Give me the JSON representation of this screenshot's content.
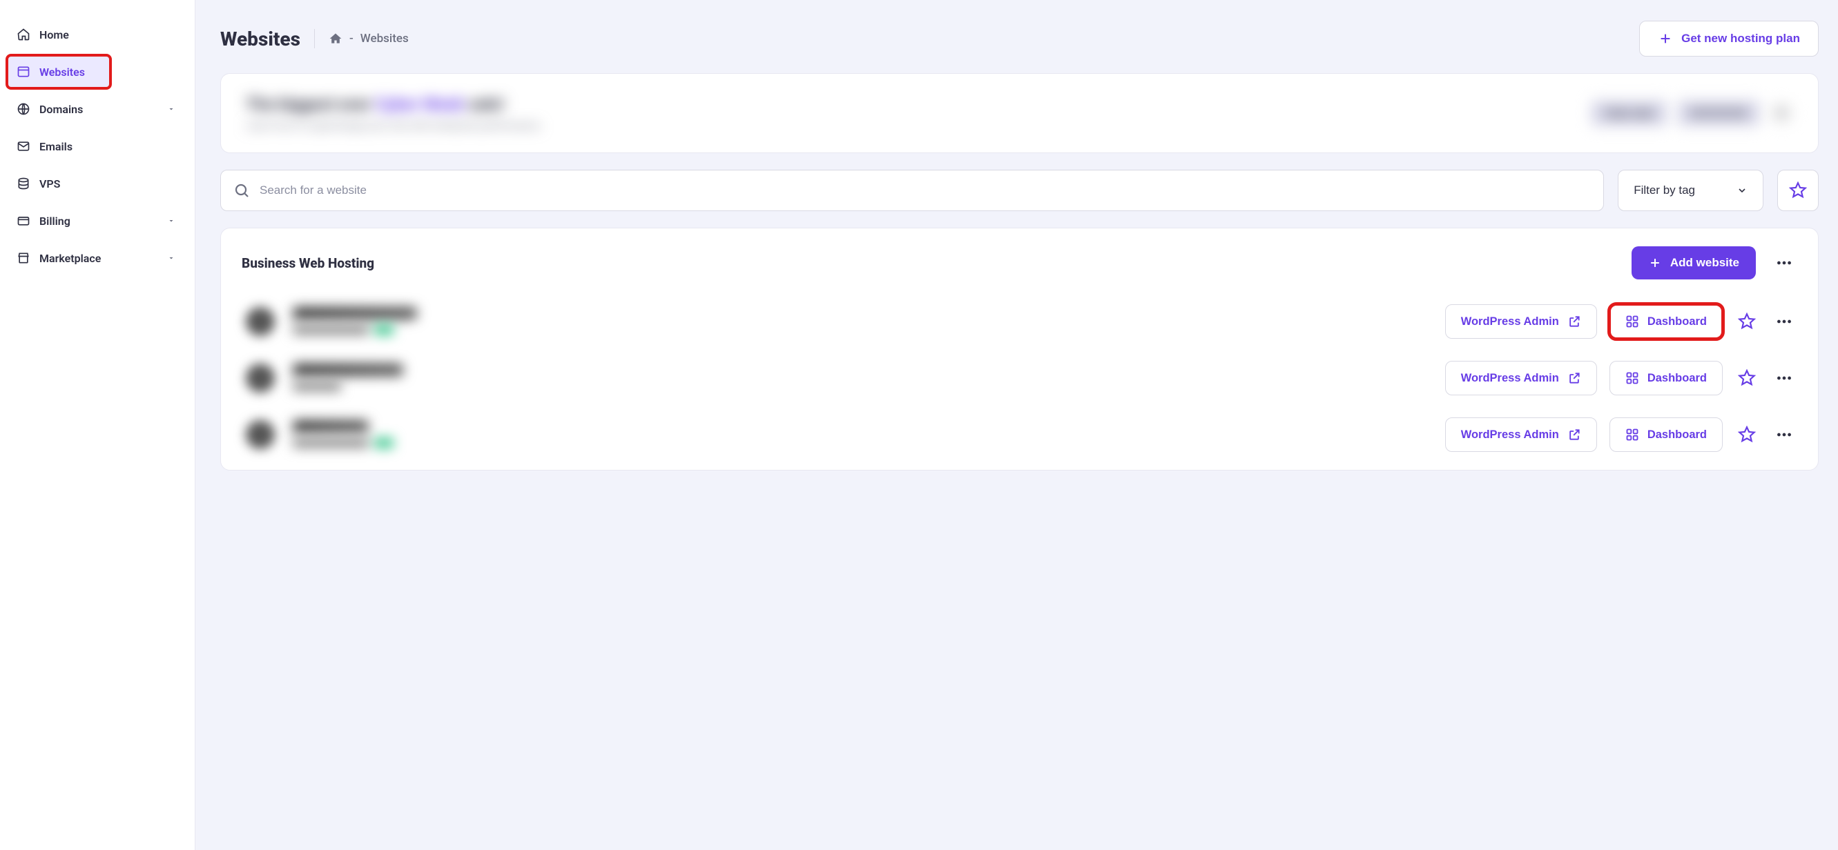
{
  "sidebar": {
    "items": [
      {
        "id": "home",
        "label": "Home",
        "icon": "home-icon",
        "expandable": false
      },
      {
        "id": "websites",
        "label": "Websites",
        "icon": "window-icon",
        "expandable": false,
        "active": true,
        "highlighted": true
      },
      {
        "id": "domains",
        "label": "Domains",
        "icon": "globe-icon",
        "expandable": true
      },
      {
        "id": "emails",
        "label": "Emails",
        "icon": "mail-icon",
        "expandable": false
      },
      {
        "id": "vps",
        "label": "VPS",
        "icon": "database-icon",
        "expandable": false
      },
      {
        "id": "billing",
        "label": "Billing",
        "icon": "card-icon",
        "expandable": true
      },
      {
        "id": "marketplace",
        "label": "Marketplace",
        "icon": "store-icon",
        "expandable": true
      }
    ]
  },
  "header": {
    "title": "Websites",
    "breadcrumb_sep": "-",
    "breadcrumb_current": "Websites",
    "new_plan_label": "Get new hosting plan"
  },
  "promo": {
    "line1_a": "The biggest ever",
    "line1_b": "Cyber Week",
    "line1_c": "sale!",
    "line2": "Learn how to supercharge your site with enterprise performance.",
    "cta": "Claim deal",
    "timer": "00 00 00 00"
  },
  "filters": {
    "search_placeholder": "Search for a website",
    "filter_label": "Filter by tag"
  },
  "hosting": {
    "title": "Business Web Hosting",
    "add_label": "Add website",
    "wp_admin_label": "WordPress Admin",
    "dashboard_label": "Dashboard",
    "rows": [
      {
        "id": "site1",
        "highlighted_dashboard": true
      },
      {
        "id": "site2",
        "highlighted_dashboard": false
      },
      {
        "id": "site3",
        "highlighted_dashboard": false
      }
    ]
  },
  "colors": {
    "accent": "#673de6",
    "highlight": "#e21b1b",
    "bg": "#f2f3fb"
  }
}
